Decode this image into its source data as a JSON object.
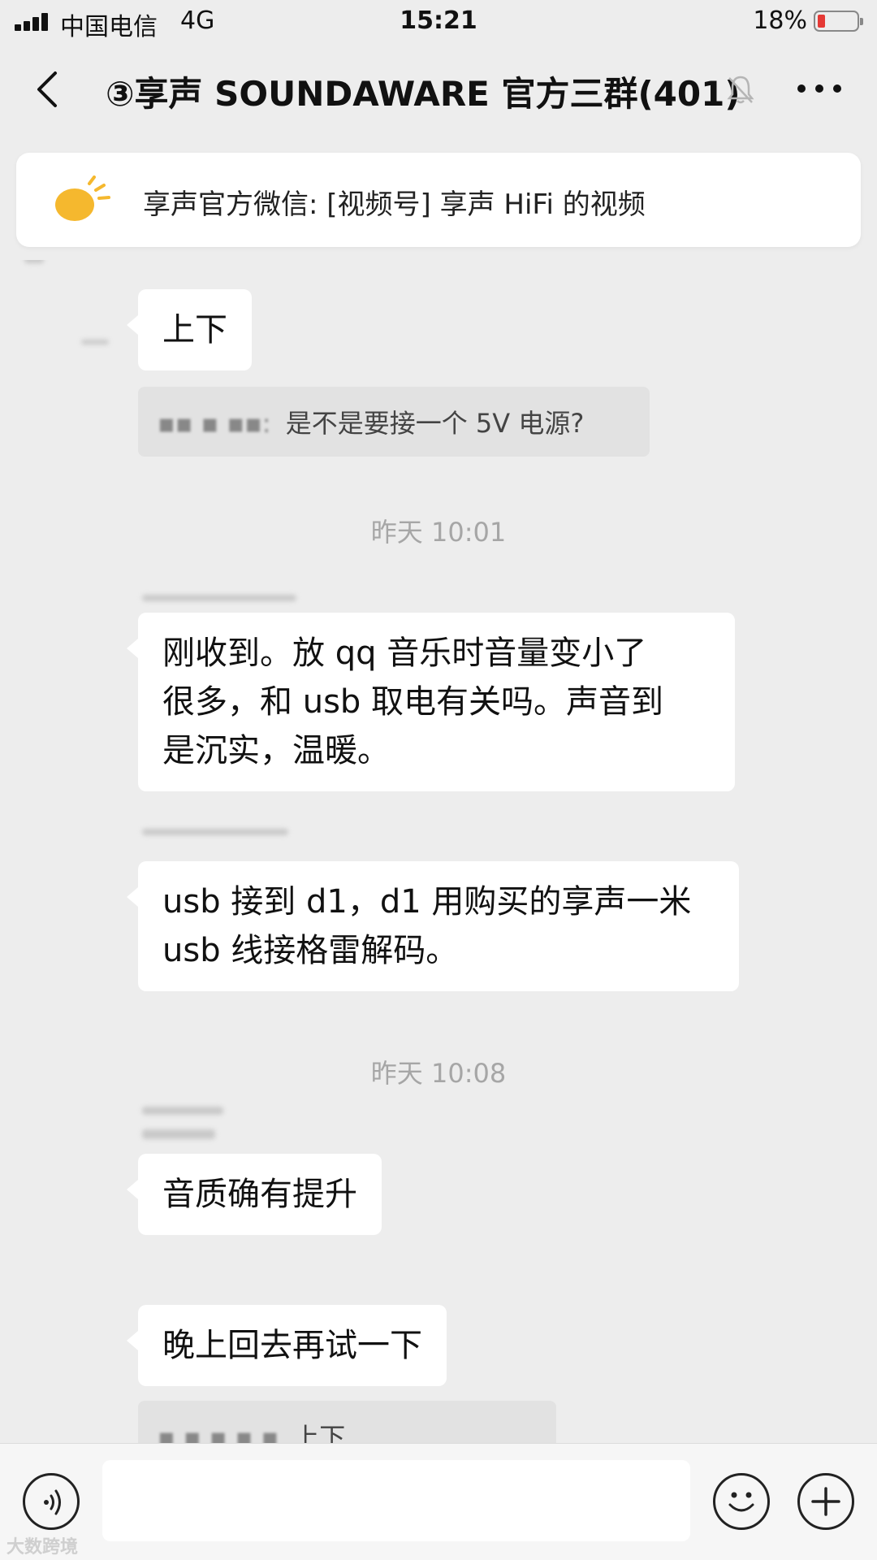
{
  "status_bar": {
    "carrier": "中国电信",
    "network": "4G",
    "time": "15:21",
    "battery_percent": "18%",
    "battery_level": 0.18,
    "battery_color": "#e53935"
  },
  "nav": {
    "title": "③享声 SOUNDAWARE 官方三群(401)",
    "back_icon": "chevron-left-icon",
    "mute_icon": "bell-off-icon",
    "more_icon": "more-dots-icon"
  },
  "pinned": {
    "icon": "lightbulb-icon",
    "icon_color": "#f5b82e",
    "text": "享声官方微信: [视频号] 享声 HiFi 的视频"
  },
  "chat": {
    "messages": [
      {
        "type": "text",
        "text": "上下"
      },
      {
        "type": "quote",
        "sender_masked": "▪▪ ▪ ▪▪:",
        "text": "是不是要接一个 5V 电源?"
      },
      {
        "type": "time",
        "text": "昨天 10:01"
      },
      {
        "type": "text",
        "lines": [
          "刚收到。放 qq 音乐时音量变小了",
          "很多，和 usb 取电有关吗。声音到",
          "是沉实，温暖。"
        ]
      },
      {
        "type": "text",
        "lines": [
          "usb 接到 d1，d1 用购买的享声一米",
          "usb 线接格雷解码。"
        ]
      },
      {
        "type": "time",
        "text": "昨天 10:08"
      },
      {
        "type": "text",
        "text": "音质确有提升"
      },
      {
        "type": "text",
        "text": "晚上回去再试一下"
      },
      {
        "type": "quote",
        "text": "上下"
      }
    ]
  },
  "input_bar": {
    "voice_icon": "voice-icon",
    "emoji_icon": "emoji-icon",
    "plus_icon": "plus-icon",
    "input_value": ""
  },
  "watermark": "大数跨境"
}
